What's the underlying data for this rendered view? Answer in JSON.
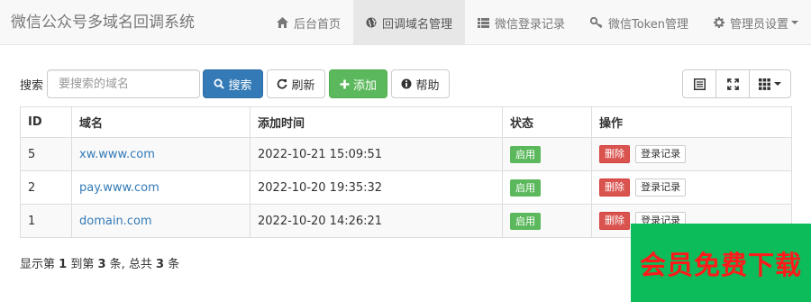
{
  "app": {
    "title": "微信公众号多域名回调系统"
  },
  "nav": [
    {
      "label": "后台首页",
      "icon": "home-icon",
      "active": false
    },
    {
      "label": "回调域名管理",
      "icon": "globe-icon",
      "active": true
    },
    {
      "label": "微信登录记录",
      "icon": "list-icon",
      "active": false
    },
    {
      "label": "微信Token管理",
      "icon": "key-icon",
      "active": false
    },
    {
      "label": "管理员设置",
      "icon": "gear-icon",
      "active": false
    }
  ],
  "toolbar": {
    "search_label": "搜索",
    "search_placeholder": "要搜索的域名",
    "search_button": "搜索",
    "refresh_button": "刷新",
    "add_button": "添加",
    "help_button": "帮助"
  },
  "table": {
    "headers": [
      "ID",
      "域名",
      "添加时间",
      "状态",
      "操作"
    ],
    "rows": [
      {
        "id": "5",
        "domain": "xw.www.com",
        "time": "2022-10-21 15:09:51",
        "status": "启用",
        "delete": "删除",
        "log": "登录记录"
      },
      {
        "id": "2",
        "domain": "pay.www.com",
        "time": "2022-10-20 19:35:32",
        "status": "启用",
        "delete": "删除",
        "log": "登录记录"
      },
      {
        "id": "1",
        "domain": "domain.com",
        "time": "2022-10-20 14:26:21",
        "status": "启用",
        "delete": "删除",
        "log": "登录记录"
      }
    ]
  },
  "pagination": {
    "prefix": "显示第 ",
    "from": "1",
    "mid1": " 到第 ",
    "to": "3",
    "mid2": " 条, 总共 ",
    "total": "3",
    "suffix": " 条"
  },
  "overlay": {
    "text": "会员免费下载"
  },
  "colors": {
    "primary": "#337ab7",
    "success": "#5cb85c",
    "danger": "#d9534f",
    "overlay": "#0cbc5a",
    "overlay_text": "#ff1a1a"
  }
}
